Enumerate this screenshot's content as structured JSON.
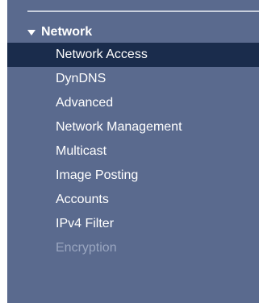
{
  "colors": {
    "panel_bg": "#5a6a8e",
    "active_bg": "#1a2c4c",
    "text": "#ffffff",
    "disabled_text": "#9aa6c0"
  },
  "section": {
    "title": "Network",
    "icon": "caret-down-icon",
    "expanded": true
  },
  "items": [
    {
      "label": "Network Access",
      "active": true,
      "disabled": false
    },
    {
      "label": "DynDNS",
      "active": false,
      "disabled": false
    },
    {
      "label": "Advanced",
      "active": false,
      "disabled": false
    },
    {
      "label": "Network Management",
      "active": false,
      "disabled": false
    },
    {
      "label": "Multicast",
      "active": false,
      "disabled": false
    },
    {
      "label": "Image Posting",
      "active": false,
      "disabled": false
    },
    {
      "label": "Accounts",
      "active": false,
      "disabled": false
    },
    {
      "label": "IPv4 Filter",
      "active": false,
      "disabled": false
    },
    {
      "label": "Encryption",
      "active": false,
      "disabled": true
    }
  ]
}
